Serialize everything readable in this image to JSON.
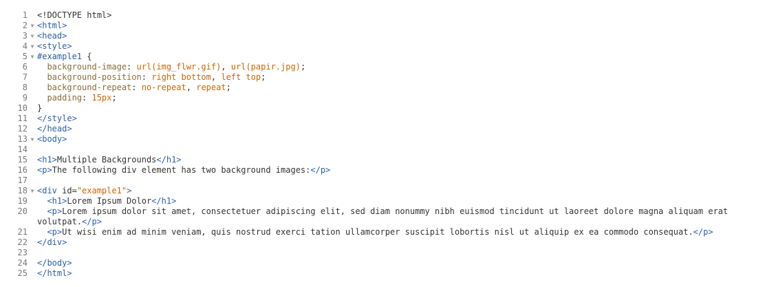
{
  "editor": {
    "lines": [
      {
        "n": "1",
        "fold": false,
        "segments": [
          {
            "c": "t-text",
            "t": "<!DOCTYPE html>"
          }
        ]
      },
      {
        "n": "2",
        "fold": true,
        "segments": [
          {
            "c": "t-tag",
            "t": "<html>"
          }
        ]
      },
      {
        "n": "3",
        "fold": true,
        "segments": [
          {
            "c": "t-tag",
            "t": "<head>"
          }
        ]
      },
      {
        "n": "4",
        "fold": true,
        "segments": [
          {
            "c": "t-tag",
            "t": "<style>"
          }
        ]
      },
      {
        "n": "5",
        "fold": true,
        "segments": [
          {
            "c": "t-sel",
            "t": "#example1"
          },
          {
            "c": "t-punct",
            "t": " {"
          }
        ]
      },
      {
        "n": "6",
        "fold": false,
        "segments": [
          {
            "c": "t-prop",
            "t": "  background-image"
          },
          {
            "c": "t-punct",
            "t": ": "
          },
          {
            "c": "t-val",
            "t": "url(img_flwr.gif)"
          },
          {
            "c": "t-punct",
            "t": ", "
          },
          {
            "c": "t-val",
            "t": "url(papir.jpg)"
          },
          {
            "c": "t-punct",
            "t": ";"
          }
        ]
      },
      {
        "n": "7",
        "fold": false,
        "segments": [
          {
            "c": "t-prop",
            "t": "  background-position"
          },
          {
            "c": "t-punct",
            "t": ": "
          },
          {
            "c": "t-val",
            "t": "right bottom"
          },
          {
            "c": "t-punct",
            "t": ", "
          },
          {
            "c": "t-val",
            "t": "left top"
          },
          {
            "c": "t-punct",
            "t": ";"
          }
        ]
      },
      {
        "n": "8",
        "fold": false,
        "segments": [
          {
            "c": "t-prop",
            "t": "  background-repeat"
          },
          {
            "c": "t-punct",
            "t": ": "
          },
          {
            "c": "t-val",
            "t": "no-repeat"
          },
          {
            "c": "t-punct",
            "t": ", "
          },
          {
            "c": "t-val",
            "t": "repeat"
          },
          {
            "c": "t-punct",
            "t": ";"
          }
        ]
      },
      {
        "n": "9",
        "fold": false,
        "segments": [
          {
            "c": "t-prop",
            "t": "  padding"
          },
          {
            "c": "t-punct",
            "t": ": "
          },
          {
            "c": "t-val",
            "t": "15px"
          },
          {
            "c": "t-punct",
            "t": ";"
          }
        ]
      },
      {
        "n": "10",
        "fold": false,
        "segments": [
          {
            "c": "t-punct",
            "t": "}"
          }
        ]
      },
      {
        "n": "11",
        "fold": false,
        "segments": [
          {
            "c": "t-tag",
            "t": "</style>"
          }
        ]
      },
      {
        "n": "12",
        "fold": false,
        "segments": [
          {
            "c": "t-tag",
            "t": "</head>"
          }
        ]
      },
      {
        "n": "13",
        "fold": true,
        "segments": [
          {
            "c": "t-tag",
            "t": "<body>"
          }
        ]
      },
      {
        "n": "14",
        "fold": false,
        "segments": []
      },
      {
        "n": "15",
        "fold": false,
        "segments": [
          {
            "c": "t-tag",
            "t": "<h1>"
          },
          {
            "c": "t-text",
            "t": "Multiple Backgrounds"
          },
          {
            "c": "t-tag",
            "t": "</h1>"
          }
        ]
      },
      {
        "n": "16",
        "fold": false,
        "segments": [
          {
            "c": "t-tag",
            "t": "<p>"
          },
          {
            "c": "t-text",
            "t": "The following div element has two background images:"
          },
          {
            "c": "t-tag",
            "t": "</p>"
          }
        ]
      },
      {
        "n": "17",
        "fold": false,
        "segments": []
      },
      {
        "n": "18",
        "fold": true,
        "segments": [
          {
            "c": "t-tag",
            "t": "<div "
          },
          {
            "c": "t-attr",
            "t": "id="
          },
          {
            "c": "t-val",
            "t": "\"example1\""
          },
          {
            "c": "t-tag",
            "t": ">"
          }
        ]
      },
      {
        "n": "19",
        "fold": false,
        "segments": [
          {
            "c": "t-text",
            "t": "  "
          },
          {
            "c": "t-tag",
            "t": "<h1>"
          },
          {
            "c": "t-text",
            "t": "Lorem Ipsum Dolor"
          },
          {
            "c": "t-tag",
            "t": "</h1>"
          }
        ]
      },
      {
        "n": "20",
        "fold": false,
        "segments": [
          {
            "c": "t-text",
            "t": "  "
          },
          {
            "c": "t-tag",
            "t": "<p>"
          },
          {
            "c": "t-text",
            "t": "Lorem ipsum dolor sit amet, consectetuer adipiscing elit, sed diam nonummy nibh euismod tincidunt ut laoreet dolore magna aliquam erat volutpat."
          },
          {
            "c": "t-tag",
            "t": "</p>"
          }
        ]
      },
      {
        "n": "21",
        "fold": false,
        "segments": [
          {
            "c": "t-text",
            "t": "  "
          },
          {
            "c": "t-tag",
            "t": "<p>"
          },
          {
            "c": "t-text",
            "t": "Ut wisi enim ad minim veniam, quis nostrud exerci tation ullamcorper suscipit lobortis nisl ut aliquip ex ea commodo consequat."
          },
          {
            "c": "t-tag",
            "t": "</p>"
          }
        ]
      },
      {
        "n": "22",
        "fold": false,
        "segments": [
          {
            "c": "t-tag",
            "t": "</div>"
          }
        ]
      },
      {
        "n": "23",
        "fold": false,
        "segments": []
      },
      {
        "n": "24",
        "fold": false,
        "segments": [
          {
            "c": "t-tag",
            "t": "</body>"
          }
        ]
      },
      {
        "n": "25",
        "fold": false,
        "segments": [
          {
            "c": "t-tag",
            "t": "</html>"
          }
        ]
      }
    ],
    "fold_glyph": "▼"
  }
}
